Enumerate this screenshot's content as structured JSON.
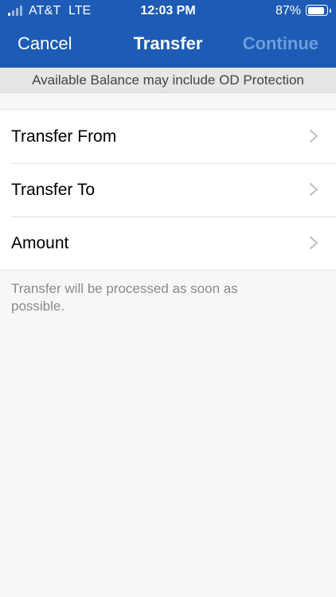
{
  "status_bar": {
    "carrier": "AT&T",
    "network": "LTE",
    "time": "12:03 PM",
    "battery_percent": "87%",
    "battery_level": 0.87
  },
  "nav": {
    "cancel_label": "Cancel",
    "title": "Transfer",
    "continue_label": "Continue"
  },
  "notice": "Available Balance may include OD Protection",
  "rows": [
    {
      "label": "Transfer From"
    },
    {
      "label": "Transfer To"
    },
    {
      "label": "Amount"
    }
  ],
  "footnote": "Transfer will be processed as soon as possible.",
  "colors": {
    "header": "#1d5bb6",
    "continue_disabled": "#6d9edb",
    "background": "#f8f7f8"
  }
}
